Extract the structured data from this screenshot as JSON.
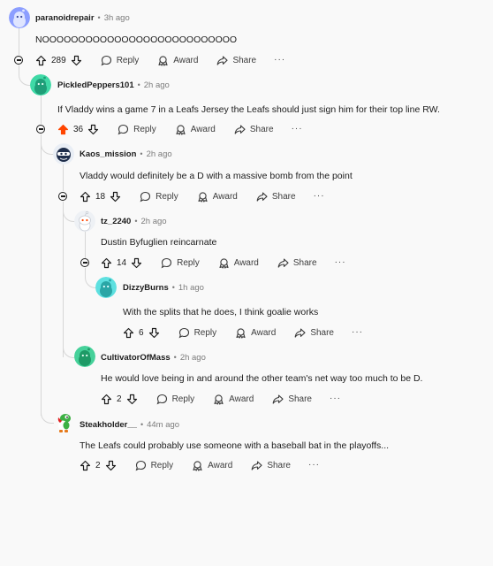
{
  "actions": {
    "reply": "Reply",
    "award": "Award",
    "share": "Share",
    "more": "···"
  },
  "colors": {
    "upvoted": "#ff4500",
    "meta_gray": "#7c7c7c",
    "thread_line": "#d6d6d6"
  },
  "comments": [
    {
      "id": "c1",
      "username": "paranoidrepair",
      "sep": "•",
      "time": "3h ago",
      "avatar": "periwinkle-snoo-icon",
      "text": "NOOOOOOOOOOOOOOOOOOOOOOOOOOO",
      "votes": "289",
      "upvoted": false
    },
    {
      "id": "c2",
      "username": "PickledPeppers101",
      "sep": "•",
      "time": "2h ago",
      "avatar": "teal-snoo-icon",
      "text": "If Vladdy wins a game 7 in a Leafs Jersey the Leafs should just sign him for their top line RW.",
      "votes": "36",
      "upvoted": true
    },
    {
      "id": "c3",
      "username": "Kaos_mission",
      "sep": "•",
      "time": "2h ago",
      "avatar": "masked-snoo-icon",
      "text": "Vladdy would definitely be a D with a massive bomb from the point",
      "votes": "18",
      "upvoted": false
    },
    {
      "id": "c4",
      "username": "tz_2240",
      "sep": "•",
      "time": "2h ago",
      "avatar": "white-snoo-icon",
      "text": "Dustin Byfuglien reincarnate",
      "votes": "14",
      "upvoted": false
    },
    {
      "id": "c5",
      "username": "DizzyBurns",
      "sep": "•",
      "time": "1h ago",
      "avatar": "cyan-snoo-icon",
      "text": "With the splits that he does, I think goalie works",
      "votes": "6",
      "upvoted": false
    },
    {
      "id": "c6",
      "username": "CultivatorOfMass",
      "sep": "•",
      "time": "2h ago",
      "avatar": "green-snoo-icon",
      "text": "He would love being in and around the other team's net way too much to be D.",
      "votes": "2",
      "upvoted": false
    },
    {
      "id": "c7",
      "username": "Steakholder__",
      "sep": "•",
      "time": "44m ago",
      "avatar": "yoshi-avatar-icon",
      "text": "The Leafs could probably use someone with a baseball bat in the playoffs...",
      "votes": "2",
      "upvoted": false
    }
  ]
}
